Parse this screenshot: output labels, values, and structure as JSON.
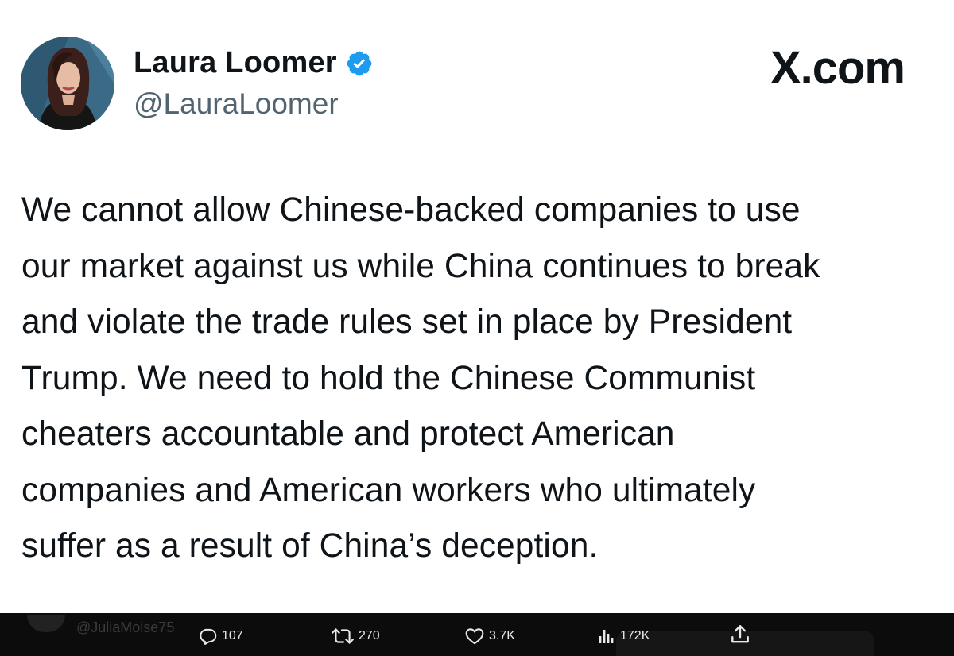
{
  "brand": "X.com",
  "author": {
    "display_name": "Laura Loomer",
    "handle": "@LauraLoomer",
    "verified": true,
    "verified_color": "#1d9bf0"
  },
  "tweet": {
    "lines": [
      "We cannot allow Chinese-backed companies to use",
      "our market against us while China continues to break",
      "and violate the trade rules set in place by President",
      "Trump. We need to hold the Chinese Communist",
      "cheaters accountable and protect American",
      "companies and American workers who ultimately",
      "suffer as a result of China’s deception."
    ]
  },
  "background_handle": "@JuliaMoise75",
  "actions": {
    "reply": {
      "icon": "reply-icon",
      "count": "107"
    },
    "repost": {
      "icon": "repost-icon",
      "count": "270"
    },
    "like": {
      "icon": "heart-icon",
      "count": "3.7K"
    },
    "views": {
      "icon": "views-icon",
      "count": "172K"
    },
    "share": {
      "icon": "share-icon"
    }
  }
}
